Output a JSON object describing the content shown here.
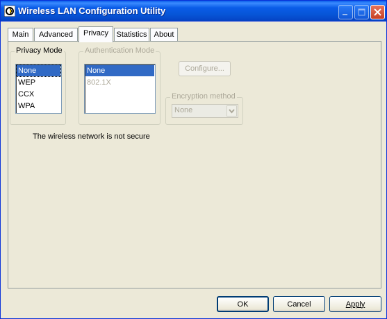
{
  "window": {
    "title": "Wireless LAN Configuration Utility"
  },
  "tabs": [
    {
      "label": "Main"
    },
    {
      "label": "Advanced"
    },
    {
      "label": "Privacy"
    },
    {
      "label": "Statistics"
    },
    {
      "label": "About"
    }
  ],
  "privacy_mode": {
    "label": "Privacy Mode",
    "options": [
      "None",
      "WEP",
      "CCX",
      "WPA"
    ],
    "selected": "None"
  },
  "auth_mode": {
    "label": "Authentication Mode",
    "options": [
      "None",
      "802.1X"
    ],
    "selected": "None"
  },
  "configure_button": "Configure...",
  "encryption": {
    "label": "Encryption method",
    "value": "None"
  },
  "status_message": "The wireless network is not secure",
  "footer": {
    "ok": "OK",
    "cancel": "Cancel",
    "apply": "Apply"
  }
}
